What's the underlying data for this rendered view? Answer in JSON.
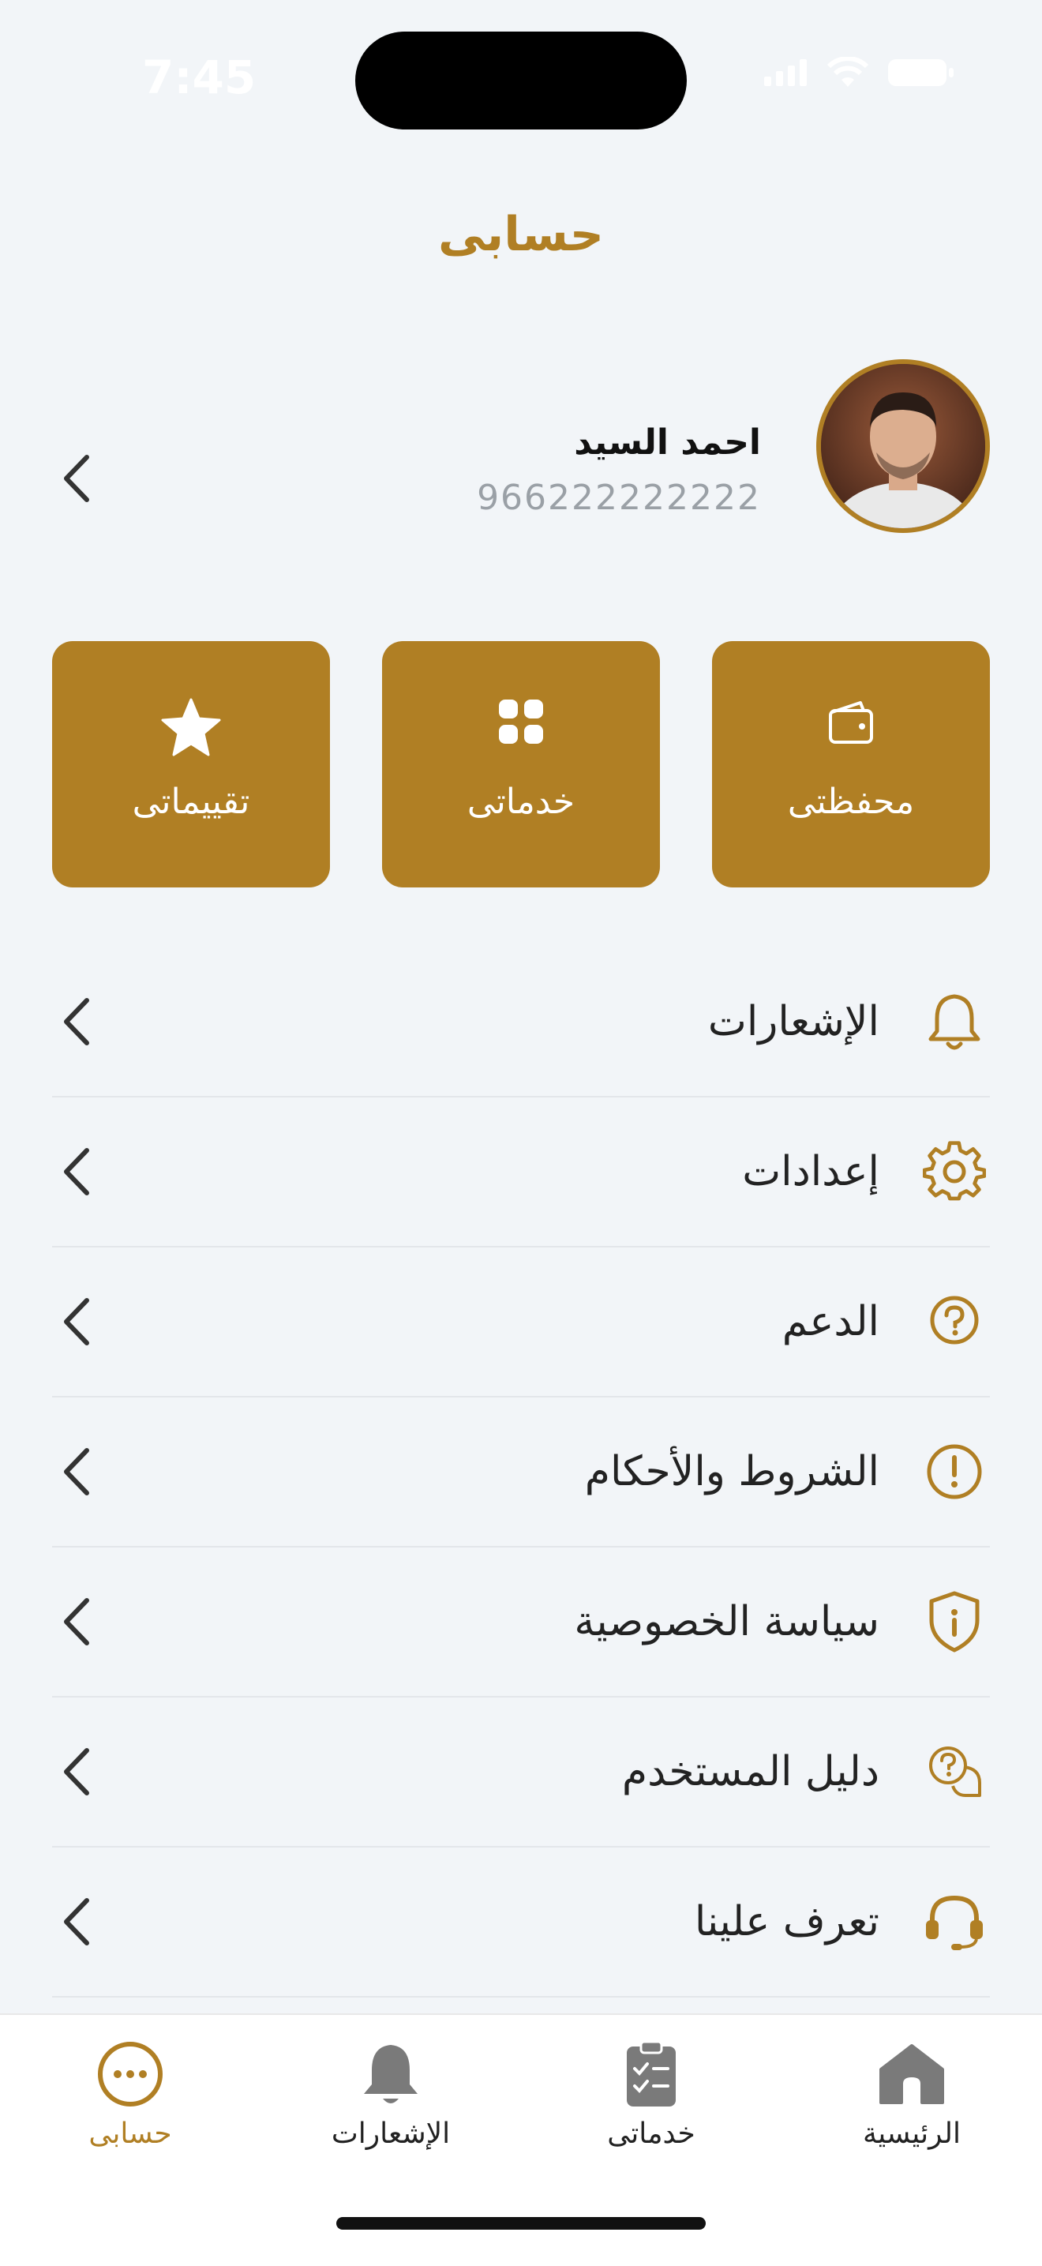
{
  "status_bar": {
    "time": "7:45"
  },
  "header": {
    "title": "حسابى"
  },
  "profile": {
    "name": "احمد السيد",
    "phone": "966222222222"
  },
  "quick_actions": [
    {
      "label": "محفظتى",
      "icon": "wallet-icon"
    },
    {
      "label": "خدماتى",
      "icon": "grid-icon"
    },
    {
      "label": "تقييماتى",
      "icon": "star-icon"
    }
  ],
  "menu": [
    {
      "label": "الإشعارات",
      "icon": "bell-icon"
    },
    {
      "label": "إعدادات",
      "icon": "gear-icon"
    },
    {
      "label": "الدعم",
      "icon": "help-icon"
    },
    {
      "label": "الشروط والأحكام",
      "icon": "alert-icon"
    },
    {
      "label": "سياسة الخصوصية",
      "icon": "shield-icon"
    },
    {
      "label": "دليل المستخدم",
      "icon": "guide-icon"
    },
    {
      "label": "تعرف علينا",
      "icon": "headset-icon"
    }
  ],
  "tabbar": [
    {
      "label": "الرئيسية",
      "icon": "home-icon",
      "active": false
    },
    {
      "label": "خدماتى",
      "icon": "clipboard-icon",
      "active": false
    },
    {
      "label": "الإشعارات",
      "icon": "bell-icon",
      "active": false
    },
    {
      "label": "حسابى",
      "icon": "more-icon",
      "active": true
    }
  ],
  "colors": {
    "accent": "#B07F24",
    "background": "#F2F5F8"
  }
}
